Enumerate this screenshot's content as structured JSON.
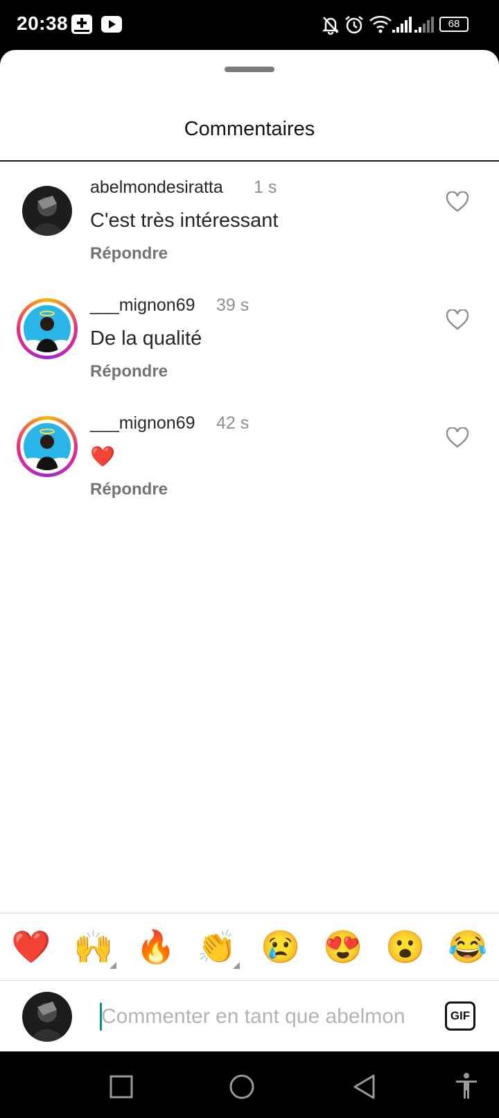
{
  "status_bar": {
    "time": "20:38",
    "battery": "68",
    "icons": [
      "add-box-icon",
      "youtube-icon",
      "notifications-off-icon",
      "alarm-icon",
      "wifi-icon",
      "signal-icon",
      "signal-icon-2",
      "battery-icon"
    ]
  },
  "sheet": {
    "title": "Commentaires"
  },
  "comments": [
    {
      "username": "abelmondesiratta",
      "time": "1 s",
      "text": "C'est très intéressant",
      "reply_label": "Répondre",
      "has_story_ring": false
    },
    {
      "username": "___mignon69",
      "time": "39 s",
      "text": "De la qualité",
      "reply_label": "Répondre",
      "has_story_ring": true
    },
    {
      "username": "___mignon69",
      "time": "42 s",
      "text": "❤️",
      "reply_label": "Répondre",
      "has_story_ring": true
    }
  ],
  "emoji_bar": {
    "emojis": [
      "❤️",
      "🙌",
      "🔥",
      "👏",
      "😢",
      "😍",
      "😮",
      "😂"
    ]
  },
  "composer": {
    "placeholder": "Commenter en tant que abelmon",
    "gif_label": "GIF"
  },
  "nav_bar": {
    "buttons": [
      "recent-apps",
      "home",
      "back",
      "accessibility"
    ]
  },
  "colors": {
    "accent_caret": "#0a8f7e",
    "secondary_text": "#737373",
    "primary_text": "#262626"
  }
}
